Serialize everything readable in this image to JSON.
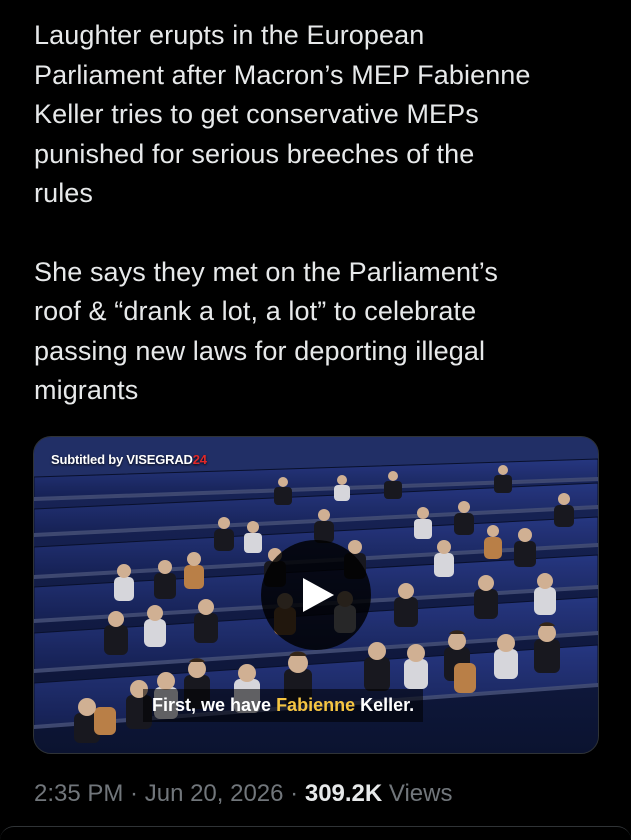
{
  "tweet": {
    "paragraph_1": "Laughter erupts in the European\nParliament after Macron’s MEP Fabienne\nKeller tries to get conservative MEPs\npunished for serious breeches of the\nrules",
    "paragraph_2": "She says they met on the Parliament’s\nroof & “drank a lot, a lot” to celebrate\npassing new laws for deporting illegal\nmigrants"
  },
  "video": {
    "watermark_prefix": "Subtitled by VISEGRAD",
    "watermark_accent": "24",
    "subtitle_before": "First, we have ",
    "subtitle_highlight": "Fabienne",
    "subtitle_after": " Keller.",
    "play_icon": "play-icon"
  },
  "meta": {
    "time": "2:35 PM",
    "separator_1": " · ",
    "date": "Jun 20, 2026",
    "separator_2": " · ",
    "views_count": "309.2K",
    "views_label": " Views"
  },
  "colors": {
    "background": "#000000",
    "text_primary": "#e7e9ea",
    "text_secondary": "#71767b",
    "subtitle_highlight": "#f5c542",
    "watermark_accent": "#e02828"
  }
}
